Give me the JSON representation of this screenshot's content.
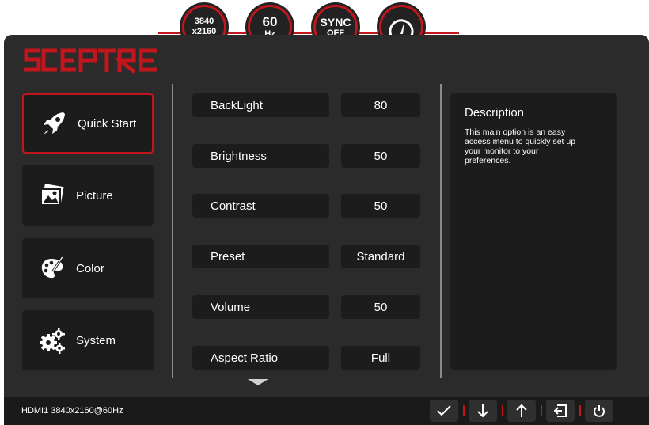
{
  "badges": [
    {
      "line1": "3840",
      "line2": "x2160"
    },
    {
      "line1": "60",
      "line2": "Hz"
    },
    {
      "line1": "SYNC",
      "line2": "OFF"
    },
    {
      "icon": "speedometer-icon"
    }
  ],
  "brand": {
    "logo_text": "SCEPTRE",
    "accent": "#c0161c"
  },
  "sidebar": {
    "items": [
      {
        "label": "Quick Start",
        "icon": "rocket-icon",
        "active": true
      },
      {
        "label": "Picture",
        "icon": "picture-icon",
        "active": false
      },
      {
        "label": "Color",
        "icon": "palette-icon",
        "active": false
      },
      {
        "label": "System",
        "icon": "gears-icon",
        "active": false
      }
    ]
  },
  "options": [
    {
      "label": "BackLight",
      "value": "80"
    },
    {
      "label": "Brightness",
      "value": "50"
    },
    {
      "label": "Contrast",
      "value": "50"
    },
    {
      "label": "Preset",
      "value": "Standard"
    },
    {
      "label": "Volume",
      "value": "50"
    },
    {
      "label": "Aspect Ratio",
      "value": "Full"
    }
  ],
  "description": {
    "title": "Description",
    "text": "This main option is an easy access menu to quickly set up your monitor to your preferences."
  },
  "status_bar": {
    "input_info": "HDMI1 3840x2160@60Hz",
    "controls": [
      "check-icon",
      "arrow-down-icon",
      "arrow-up-icon",
      "exit-icon",
      "power-icon"
    ]
  }
}
